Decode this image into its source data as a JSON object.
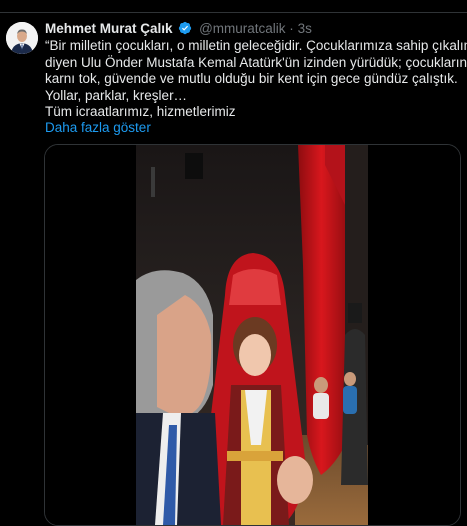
{
  "tweet": {
    "author_name": "Mehmet Murat Çalık",
    "handle": "@mmuratcalik",
    "separator": "·",
    "time": "3s",
    "lines": [
      "“Bir milletin çocukları, o milletin geleceğidir. Çocuklarımıza sahip çıkalım”",
      "diyen Ulu Önder Mustafa Kemal Atatürk'ün izinden yürüdük; çocukların",
      "karnı tok, güvende ve mutlu olduğu bir kent için gece gündüz çalıştık.",
      "Yollar, parklar, kreşler…",
      "Tüm icraatlarımız, hizmetlerimiz"
    ],
    "show_more": "Daha fazla göster"
  },
  "icons": {
    "verified": "verified-badge-icon",
    "avatar": "profile-avatar"
  },
  "colors": {
    "background": "#000000",
    "text": "#e7e9ea",
    "muted": "#71767b",
    "link": "#1d9bf0",
    "verified": "#1d9bf0",
    "curtain": "#c8141a"
  }
}
